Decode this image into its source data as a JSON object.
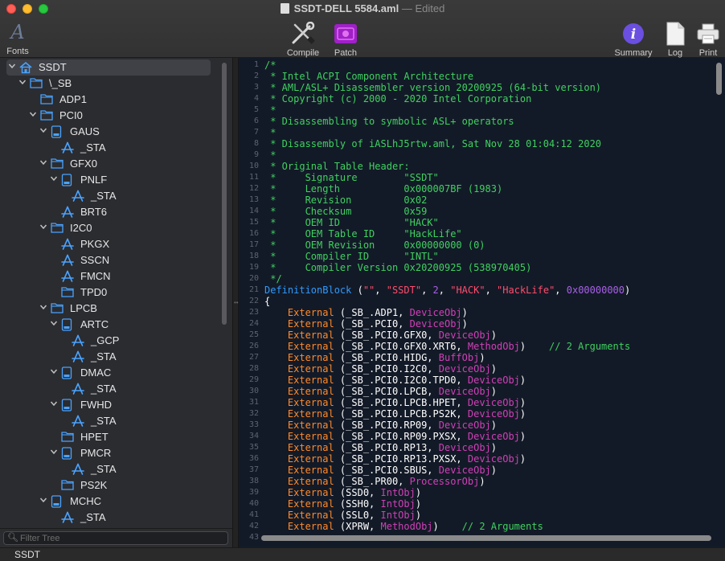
{
  "window": {
    "title": "SSDT-DELL 5584.aml",
    "edited": "— Edited"
  },
  "toolbar": {
    "fonts": "Fonts",
    "compile": "Compile",
    "patch": "Patch",
    "summary": "Summary",
    "log": "Log",
    "print": "Print"
  },
  "tree": [
    {
      "label": "SSDT",
      "depth": 0,
      "icon": "house-icon",
      "expanded": true,
      "selected": true
    },
    {
      "label": "\\_SB",
      "depth": 1,
      "icon": "folder-icon",
      "expanded": true
    },
    {
      "label": "ADP1",
      "depth": 2,
      "icon": "folder-icon"
    },
    {
      "label": "PCI0",
      "depth": 2,
      "icon": "folder-icon",
      "expanded": true
    },
    {
      "label": "GAUS",
      "depth": 3,
      "icon": "device-icon",
      "expanded": true
    },
    {
      "label": "_STA",
      "depth": 4,
      "icon": "method-icon"
    },
    {
      "label": "GFX0",
      "depth": 3,
      "icon": "folder-icon",
      "expanded": true
    },
    {
      "label": "PNLF",
      "depth": 4,
      "icon": "device-icon",
      "expanded": true
    },
    {
      "label": "_STA",
      "depth": 5,
      "icon": "method-icon"
    },
    {
      "label": "BRT6",
      "depth": 4,
      "icon": "method-icon"
    },
    {
      "label": "I2C0",
      "depth": 3,
      "icon": "folder-icon",
      "expanded": true
    },
    {
      "label": "PKGX",
      "depth": 4,
      "icon": "method-icon"
    },
    {
      "label": "SSCN",
      "depth": 4,
      "icon": "method-icon"
    },
    {
      "label": "FMCN",
      "depth": 4,
      "icon": "method-icon"
    },
    {
      "label": "TPD0",
      "depth": 4,
      "icon": "folder-icon"
    },
    {
      "label": "LPCB",
      "depth": 3,
      "icon": "folder-icon",
      "expanded": true
    },
    {
      "label": "ARTC",
      "depth": 4,
      "icon": "device-icon",
      "expanded": true
    },
    {
      "label": "_GCP",
      "depth": 5,
      "icon": "method-icon"
    },
    {
      "label": "_STA",
      "depth": 5,
      "icon": "method-icon"
    },
    {
      "label": "DMAC",
      "depth": 4,
      "icon": "device-icon",
      "expanded": true
    },
    {
      "label": "_STA",
      "depth": 5,
      "icon": "method-icon"
    },
    {
      "label": "FWHD",
      "depth": 4,
      "icon": "device-icon",
      "expanded": true
    },
    {
      "label": "_STA",
      "depth": 5,
      "icon": "method-icon"
    },
    {
      "label": "HPET",
      "depth": 4,
      "icon": "folder-icon"
    },
    {
      "label": "PMCR",
      "depth": 4,
      "icon": "device-icon",
      "expanded": true
    },
    {
      "label": "_STA",
      "depth": 5,
      "icon": "method-icon"
    },
    {
      "label": "PS2K",
      "depth": 4,
      "icon": "folder-icon"
    },
    {
      "label": "MCHC",
      "depth": 3,
      "icon": "device-icon",
      "expanded": true
    },
    {
      "label": "_STA",
      "depth": 4,
      "icon": "method-icon"
    }
  ],
  "filter": {
    "placeholder": "Filter Tree"
  },
  "status": "SSDT",
  "code_lines": [
    [
      [
        "comment",
        "/*"
      ]
    ],
    [
      [
        "comment",
        " * Intel ACPI Component Architecture"
      ]
    ],
    [
      [
        "comment",
        " * AML/ASL+ Disassembler version 20200925 (64-bit version)"
      ]
    ],
    [
      [
        "comment",
        " * Copyright (c) 2000 - 2020 Intel Corporation"
      ]
    ],
    [
      [
        "comment",
        " *"
      ]
    ],
    [
      [
        "comment",
        " * Disassembling to symbolic ASL+ operators"
      ]
    ],
    [
      [
        "comment",
        " *"
      ]
    ],
    [
      [
        "comment",
        " * Disassembly of iASLhJ5rtw.aml, Sat Nov 28 01:04:12 2020"
      ]
    ],
    [
      [
        "comment",
        " *"
      ]
    ],
    [
      [
        "comment",
        " * Original Table Header:"
      ]
    ],
    [
      [
        "comment",
        " *     Signature        \"SSDT\""
      ]
    ],
    [
      [
        "comment",
        " *     Length           0x000007BF (1983)"
      ]
    ],
    [
      [
        "comment",
        " *     Revision         0x02"
      ]
    ],
    [
      [
        "comment",
        " *     Checksum         0x59"
      ]
    ],
    [
      [
        "comment",
        " *     OEM ID           \"HACK\""
      ]
    ],
    [
      [
        "comment",
        " *     OEM Table ID     \"HackLife\""
      ]
    ],
    [
      [
        "comment",
        " *     OEM Revision     0x00000000 (0)"
      ]
    ],
    [
      [
        "comment",
        " *     Compiler ID      \"INTL\""
      ]
    ],
    [
      [
        "comment",
        " *     Compiler Version 0x20200925 (538970405)"
      ]
    ],
    [
      [
        "comment",
        " */"
      ]
    ],
    [
      [
        "def",
        "DefinitionBlock"
      ],
      [
        "plain",
        " ("
      ],
      [
        "str",
        "\"\""
      ],
      [
        "plain",
        ", "
      ],
      [
        "str",
        "\"SSDT\""
      ],
      [
        "plain",
        ", "
      ],
      [
        "num",
        "2"
      ],
      [
        "plain",
        ", "
      ],
      [
        "str",
        "\"HACK\""
      ],
      [
        "plain",
        ", "
      ],
      [
        "str",
        "\"HackLife\""
      ],
      [
        "plain",
        ", "
      ],
      [
        "num",
        "0x00000000"
      ],
      [
        "plain",
        ")"
      ]
    ],
    [
      [
        "plain",
        "{"
      ]
    ],
    [
      [
        "plain",
        "    "
      ],
      [
        "kw",
        "External"
      ],
      [
        "plain",
        " (_SB_.ADP1, "
      ],
      [
        "obj",
        "DeviceObj"
      ],
      [
        "plain",
        ")"
      ]
    ],
    [
      [
        "plain",
        "    "
      ],
      [
        "kw",
        "External"
      ],
      [
        "plain",
        " (_SB_.PCI0, "
      ],
      [
        "obj",
        "DeviceObj"
      ],
      [
        "plain",
        ")"
      ]
    ],
    [
      [
        "plain",
        "    "
      ],
      [
        "kw",
        "External"
      ],
      [
        "plain",
        " (_SB_.PCI0.GFX0, "
      ],
      [
        "obj",
        "DeviceObj"
      ],
      [
        "plain",
        ")"
      ]
    ],
    [
      [
        "plain",
        "    "
      ],
      [
        "kw",
        "External"
      ],
      [
        "plain",
        " (_SB_.PCI0.GFX0.XRT6, "
      ],
      [
        "obj",
        "MethodObj"
      ],
      [
        "plain",
        ")    "
      ],
      [
        "comment",
        "// 2 Arguments"
      ]
    ],
    [
      [
        "plain",
        "    "
      ],
      [
        "kw",
        "External"
      ],
      [
        "plain",
        " (_SB_.PCI0.HIDG, "
      ],
      [
        "obj",
        "BuffObj"
      ],
      [
        "plain",
        ")"
      ]
    ],
    [
      [
        "plain",
        "    "
      ],
      [
        "kw",
        "External"
      ],
      [
        "plain",
        " (_SB_.PCI0.I2C0, "
      ],
      [
        "obj",
        "DeviceObj"
      ],
      [
        "plain",
        ")"
      ]
    ],
    [
      [
        "plain",
        "    "
      ],
      [
        "kw",
        "External"
      ],
      [
        "plain",
        " (_SB_.PCI0.I2C0.TPD0, "
      ],
      [
        "obj",
        "DeviceObj"
      ],
      [
        "plain",
        ")"
      ]
    ],
    [
      [
        "plain",
        "    "
      ],
      [
        "kw",
        "External"
      ],
      [
        "plain",
        " (_SB_.PCI0.LPCB, "
      ],
      [
        "obj",
        "DeviceObj"
      ],
      [
        "plain",
        ")"
      ]
    ],
    [
      [
        "plain",
        "    "
      ],
      [
        "kw",
        "External"
      ],
      [
        "plain",
        " (_SB_.PCI0.LPCB.HPET, "
      ],
      [
        "obj",
        "DeviceObj"
      ],
      [
        "plain",
        ")"
      ]
    ],
    [
      [
        "plain",
        "    "
      ],
      [
        "kw",
        "External"
      ],
      [
        "plain",
        " (_SB_.PCI0.LPCB.PS2K, "
      ],
      [
        "obj",
        "DeviceObj"
      ],
      [
        "plain",
        ")"
      ]
    ],
    [
      [
        "plain",
        "    "
      ],
      [
        "kw",
        "External"
      ],
      [
        "plain",
        " (_SB_.PCI0.RP09, "
      ],
      [
        "obj",
        "DeviceObj"
      ],
      [
        "plain",
        ")"
      ]
    ],
    [
      [
        "plain",
        "    "
      ],
      [
        "kw",
        "External"
      ],
      [
        "plain",
        " (_SB_.PCI0.RP09.PXSX, "
      ],
      [
        "obj",
        "DeviceObj"
      ],
      [
        "plain",
        ")"
      ]
    ],
    [
      [
        "plain",
        "    "
      ],
      [
        "kw",
        "External"
      ],
      [
        "plain",
        " (_SB_.PCI0.RP13, "
      ],
      [
        "obj",
        "DeviceObj"
      ],
      [
        "plain",
        ")"
      ]
    ],
    [
      [
        "plain",
        "    "
      ],
      [
        "kw",
        "External"
      ],
      [
        "plain",
        " (_SB_.PCI0.RP13.PXSX, "
      ],
      [
        "obj",
        "DeviceObj"
      ],
      [
        "plain",
        ")"
      ]
    ],
    [
      [
        "plain",
        "    "
      ],
      [
        "kw",
        "External"
      ],
      [
        "plain",
        " (_SB_.PCI0.SBUS, "
      ],
      [
        "obj",
        "DeviceObj"
      ],
      [
        "plain",
        ")"
      ]
    ],
    [
      [
        "plain",
        "    "
      ],
      [
        "kw",
        "External"
      ],
      [
        "plain",
        " (_SB_.PR00, "
      ],
      [
        "obj",
        "ProcessorObj"
      ],
      [
        "plain",
        ")"
      ]
    ],
    [
      [
        "plain",
        "    "
      ],
      [
        "kw",
        "External"
      ],
      [
        "plain",
        " (SSD0, "
      ],
      [
        "obj",
        "IntObj"
      ],
      [
        "plain",
        ")"
      ]
    ],
    [
      [
        "plain",
        "    "
      ],
      [
        "kw",
        "External"
      ],
      [
        "plain",
        " (SSH0, "
      ],
      [
        "obj",
        "IntObj"
      ],
      [
        "plain",
        ")"
      ]
    ],
    [
      [
        "plain",
        "    "
      ],
      [
        "kw",
        "External"
      ],
      [
        "plain",
        " (SSL0, "
      ],
      [
        "obj",
        "IntObj"
      ],
      [
        "plain",
        ")"
      ]
    ],
    [
      [
        "plain",
        "    "
      ],
      [
        "kw",
        "External"
      ],
      [
        "plain",
        " (XPRW, "
      ],
      [
        "obj",
        "MethodObj"
      ],
      [
        "plain",
        ")    "
      ],
      [
        "comment",
        "// 2 Arguments"
      ]
    ],
    [
      [
        "plain",
        ""
      ]
    ]
  ],
  "colors": {
    "comment": "#3fd161",
    "keyword": "#ff8a2a",
    "object_type": "#d040b8",
    "string": "#ff4d6d",
    "number": "#a860e8",
    "definition": "#2f9bff",
    "editor_bg": "#131a27",
    "sidebar_bg": "#2b2c30"
  }
}
